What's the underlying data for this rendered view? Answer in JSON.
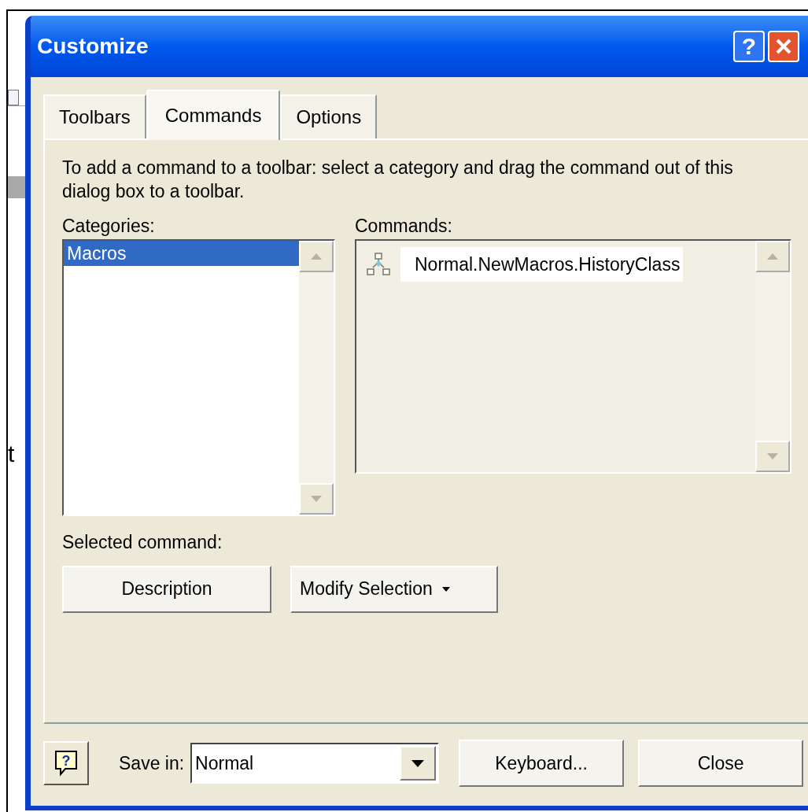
{
  "background_text": "t",
  "window": {
    "title": "Customize",
    "help_button": "?"
  },
  "tabs": [
    {
      "label": "Toolbars",
      "selected": false
    },
    {
      "label": "Commands",
      "selected": true
    },
    {
      "label": "Options",
      "selected": false
    }
  ],
  "instructions": "To add a command to a toolbar: select a category and drag the command out of this dialog box to a toolbar.",
  "categories": {
    "label": "Categories:",
    "items": [
      {
        "label": "Macros",
        "selected": true
      }
    ]
  },
  "commands": {
    "label": "Commands:",
    "items": [
      {
        "label": "Normal.NewMacros.HistoryClass",
        "selected": false
      }
    ]
  },
  "selected_command": {
    "label": "Selected command:",
    "buttons": [
      {
        "label": "Description",
        "kind": "plain"
      },
      {
        "label": "Modify Selection",
        "kind": "menu"
      }
    ]
  },
  "footer": {
    "help_button": "?",
    "save_in": {
      "label": "Save in:",
      "value": "Normal"
    },
    "buttons": [
      "Keyboard...",
      "Close"
    ]
  }
}
